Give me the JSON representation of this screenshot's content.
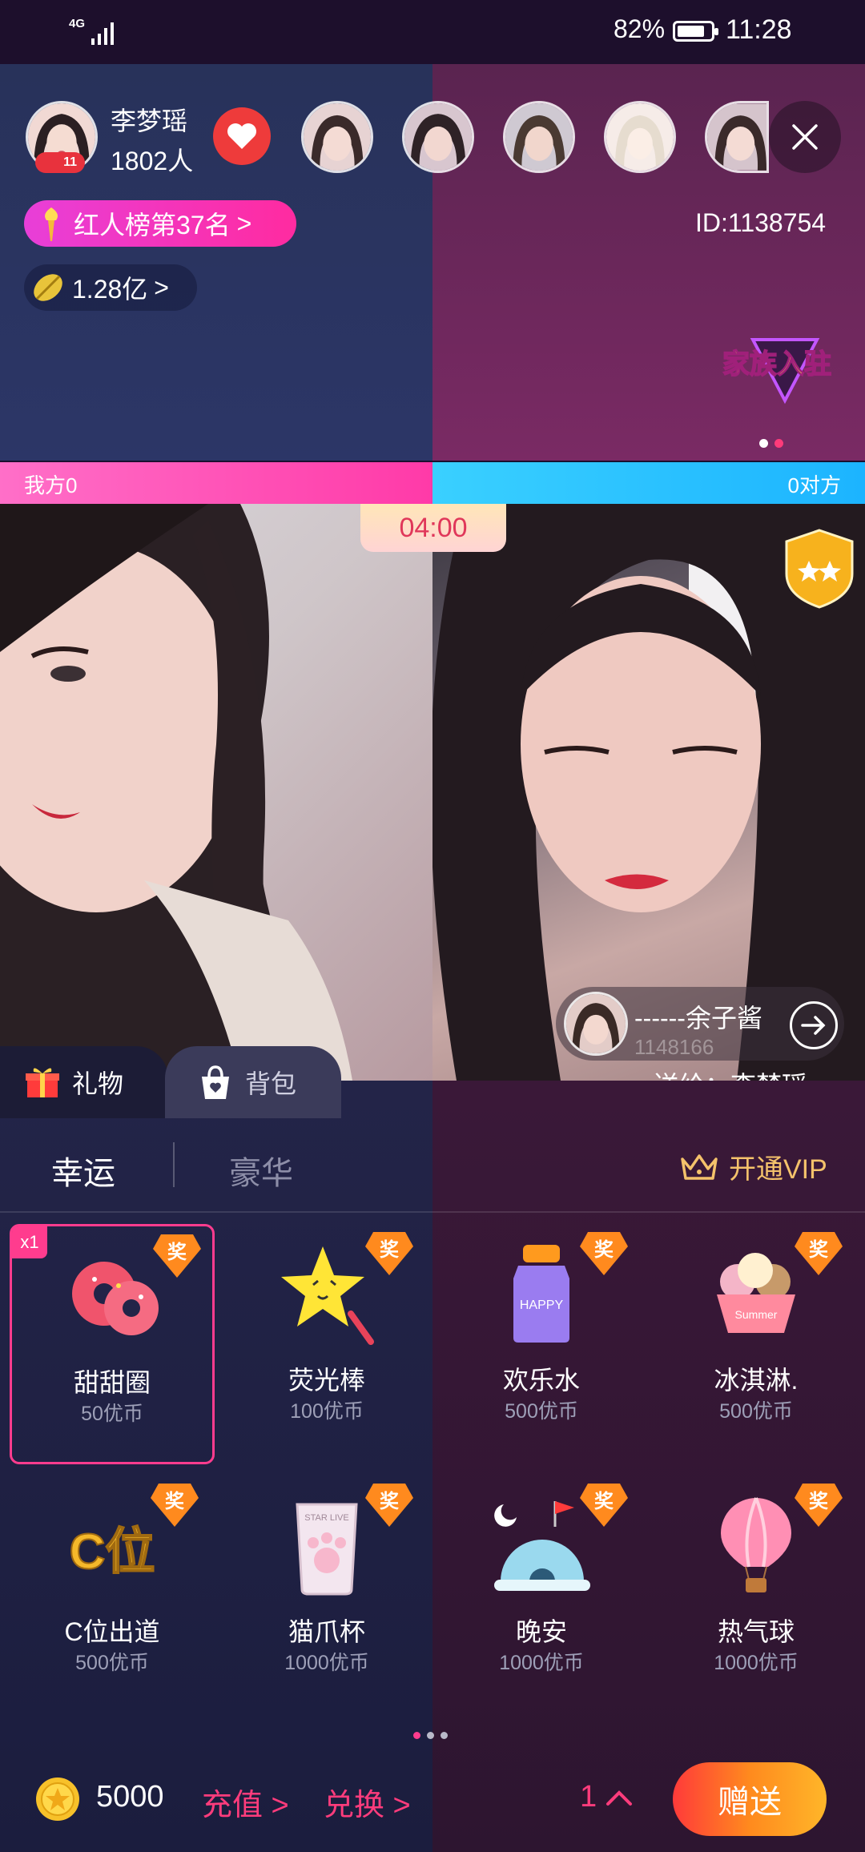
{
  "status_bar": {
    "network": "4G",
    "battery_pct": "82%",
    "battery_level": 0.82,
    "time": "11:28"
  },
  "host": {
    "name": "李梦瑶",
    "viewers": "1802人",
    "level": "11"
  },
  "rank": {
    "label": "红人榜第37名",
    "arrow": ">"
  },
  "coins": {
    "label": "1.28亿",
    "arrow": ">"
  },
  "room_id": "ID:1138754",
  "icons": {
    "heart": "heart-icon",
    "close": "close-icon",
    "torch": "torch-icon",
    "leaf": "leaf-coin-icon",
    "gift": "gift-icon",
    "bag": "bag-icon",
    "crown": "crown-icon",
    "coin": "coin-icon"
  },
  "pk": {
    "left_label": "我方0",
    "right_label": "0对方",
    "timer": "04:00"
  },
  "sender": {
    "name": "------余子酱",
    "id": "1148166",
    "send_to": "送给：李梦瑶"
  },
  "tabs": {
    "gift": "礼物",
    "bag": "背包"
  },
  "categories": {
    "lucky": "幸运",
    "luxury": "豪华",
    "vip": "开通VIP"
  },
  "gifts": [
    {
      "name": "甜甜圈",
      "price": "50优币",
      "badge": "奖",
      "selected": true,
      "count_badge": "x1"
    },
    {
      "name": "荧光棒",
      "price": "100优币",
      "badge": "奖"
    },
    {
      "name": "欢乐水",
      "price": "500优币",
      "badge": "奖"
    },
    {
      "name": "冰淇淋.",
      "price": "500优币",
      "badge": "奖"
    },
    {
      "name": "C位出道",
      "price": "500优币",
      "badge": "奖"
    },
    {
      "name": "猫爪杯",
      "price": "1000优币",
      "badge": "奖"
    },
    {
      "name": "晚安",
      "price": "1000优币",
      "badge": "奖"
    },
    {
      "name": "热气球",
      "price": "1000优币",
      "badge": "奖"
    }
  ],
  "gift_art": {
    "happy_label": "HAPPY",
    "c_label": "C位",
    "summer_label": "Summer",
    "cup_label": "STAR LIVE"
  },
  "family_badge": "家族入驻",
  "bottom": {
    "balance": "5000",
    "recharge": "充值 >",
    "exchange": "兑换 >",
    "quantity": "1",
    "send": "赠送"
  },
  "colors": {
    "accent": "#ff3c8e",
    "vip_gold": "#f4c26b",
    "left_team": "#ff3aa8",
    "right_team": "#1cb4ff"
  }
}
